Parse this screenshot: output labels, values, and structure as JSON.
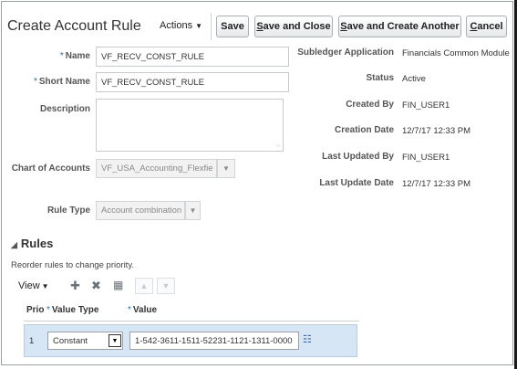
{
  "header": {
    "title": "Create Account Rule",
    "actions_label": "Actions",
    "buttons": {
      "save": "Save",
      "save_and_close": "Save and Close",
      "save_and_create_another": "Save and Create Another",
      "cancel": "Cancel"
    }
  },
  "form": {
    "name_label": "Name",
    "name_value": "VF_RECV_CONST_RULE",
    "short_name_label": "Short Name",
    "short_name_value": "VF_RECV_CONST_RULE",
    "description_label": "Description",
    "description_value": "",
    "chart_of_accounts_label": "Chart of Accounts",
    "chart_of_accounts_value": "VF_USA_Accounting_Flexfie",
    "rule_type_label": "Rule Type",
    "rule_type_value": "Account combination",
    "required_marker": "*"
  },
  "info": {
    "subledger_application_label": "Subledger Application",
    "subledger_application_value": "Financials Common Module",
    "status_label": "Status",
    "status_value": "Active",
    "created_by_label": "Created By",
    "created_by_value": "FIN_USER1",
    "creation_date_label": "Creation Date",
    "creation_date_value": "12/7/17 12:33 PM",
    "last_updated_by_label": "Last Updated By",
    "last_updated_by_value": "FIN_USER1",
    "last_update_date_label": "Last Update Date",
    "last_update_date_value": "12/7/17 12:33 PM"
  },
  "rules": {
    "section_title": "Rules",
    "description": "Reorder rules to change priority.",
    "toolbar": {
      "view_label": "View",
      "icons": [
        "add-icon",
        "delete-icon",
        "detach-icon",
        "move-up-icon",
        "move-down-icon"
      ]
    },
    "columns": [
      "Prio",
      "Value Type",
      "Value"
    ],
    "rows": [
      {
        "priority": "1",
        "value_type": "Constant",
        "value": "1-542-3611-1511-52231-1121-1311-0000"
      }
    ]
  },
  "colors": {
    "required_asterisk": "#1e6fb3",
    "selected_row": "#d6e6f5",
    "lookup_icon": "#2d6fb0"
  }
}
